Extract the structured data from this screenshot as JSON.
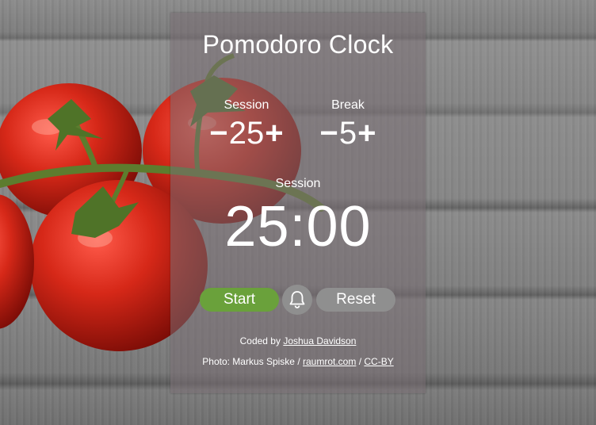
{
  "app": {
    "title": "Pomodoro Clock"
  },
  "session": {
    "label": "Session",
    "value": "25",
    "minus": "−",
    "plus": "+"
  },
  "break": {
    "label": "Break",
    "value": "5",
    "minus": "−",
    "plus": "+"
  },
  "timer": {
    "mode": "Session",
    "display": "25:00"
  },
  "controls": {
    "start_label": "Start",
    "reset_label": "Reset",
    "bell_icon": "bell-icon"
  },
  "credits": {
    "coded_prefix": "Coded by",
    "coded_author": "Joshua Davidson",
    "photo_prefix": "Photo: Markus Spiske /",
    "photo_site": "raumrot.com",
    "separator": "/",
    "license": "CC-BY"
  },
  "colors": {
    "accent": "#6aa13b",
    "button_gray": "#8f8f8f",
    "panel": "#786e73"
  }
}
